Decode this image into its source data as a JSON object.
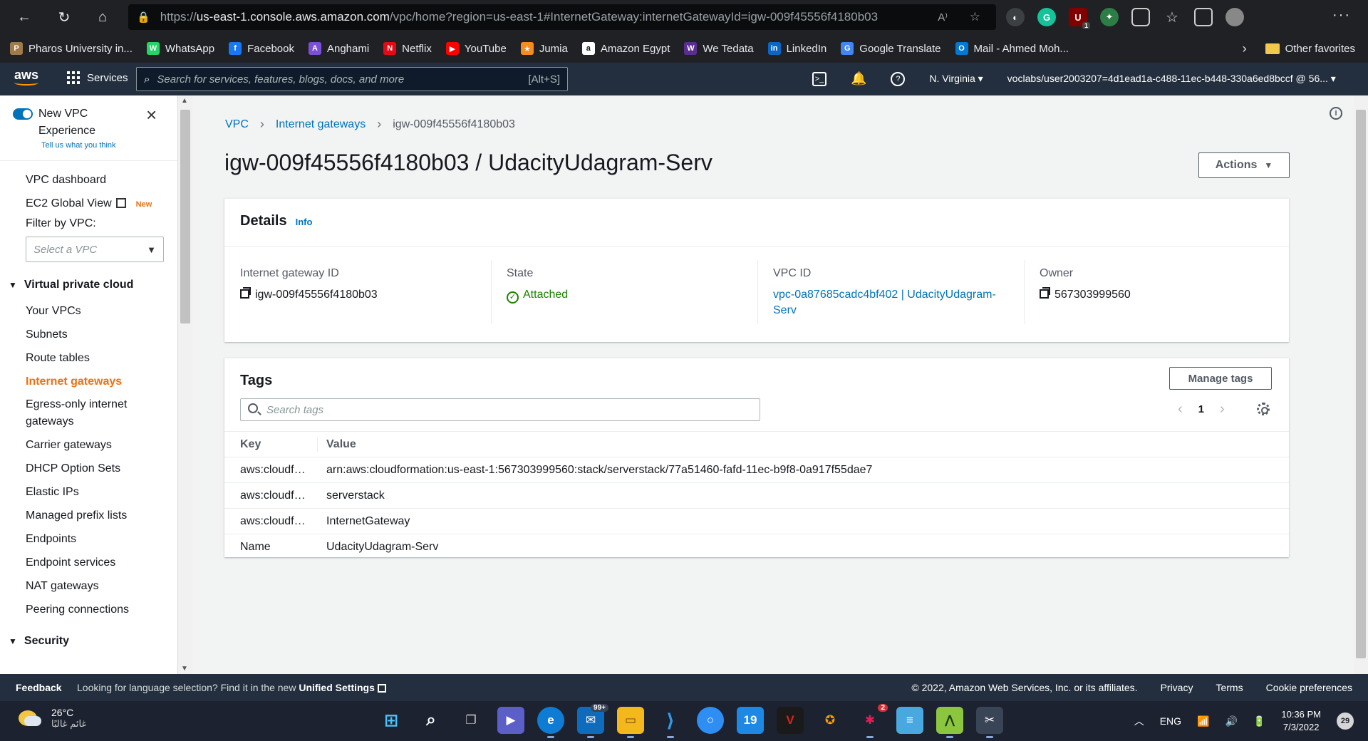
{
  "browser": {
    "url_prefix": "https://",
    "url_host": "us-east-1.console.aws.amazon.com",
    "url_path": "/vpc/home?region=us-east-1#InternetGateway:internetGatewayId=igw-009f45556f4180b03",
    "extension_badge": "1",
    "bookmarks": [
      {
        "label": "Pharos University in...",
        "color": "#a07a4a",
        "glyph": "P"
      },
      {
        "label": "WhatsApp",
        "color": "#25d366",
        "glyph": "W"
      },
      {
        "label": "Facebook",
        "color": "#1877f2",
        "glyph": "f"
      },
      {
        "label": "Anghami",
        "color": "#7b4fd6",
        "glyph": "A"
      },
      {
        "label": "Netflix",
        "color": "#e50914",
        "glyph": "N"
      },
      {
        "label": "YouTube",
        "color": "#ff0000",
        "glyph": "▶"
      },
      {
        "label": "Jumia",
        "color": "#f68b1e",
        "glyph": "★"
      },
      {
        "label": "Amazon Egypt",
        "color": "#ffffff",
        "glyph": "a"
      },
      {
        "label": "We Tedata",
        "color": "#5c2d91",
        "glyph": "W"
      },
      {
        "label": "LinkedIn",
        "color": "#0a66c2",
        "glyph": "in"
      },
      {
        "label": "Google Translate",
        "color": "#4285f4",
        "glyph": "G"
      },
      {
        "label": "Mail - Ahmed Moh...",
        "color": "#0078d4",
        "glyph": "O"
      }
    ],
    "other_favorites": "Other favorites"
  },
  "aws_header": {
    "logo": "aws",
    "services": "Services",
    "search_placeholder": "Search for services, features, blogs, docs, and more",
    "search_shortcut": "[Alt+S]",
    "region": "N. Virginia",
    "account": "voclabs/user2003207=4d1ead1a-c488-11ec-b448-330a6ed8bccf @ 56..."
  },
  "sidebar": {
    "new_vpc_label": "New VPC Experience",
    "feedback_link": "Tell us what you think",
    "top_items": [
      "VPC dashboard",
      "EC2 Global View"
    ],
    "new_badge": "New",
    "filter_label": "Filter by VPC:",
    "filter_placeholder": "Select a VPC",
    "section_vpc": "Virtual private cloud",
    "items": [
      "Your VPCs",
      "Subnets",
      "Route tables",
      "Internet gateways",
      "Egress-only internet gateways",
      "Carrier gateways",
      "DHCP Option Sets",
      "Elastic IPs",
      "Managed prefix lists",
      "Endpoints",
      "Endpoint services",
      "NAT gateways",
      "Peering connections"
    ],
    "active_item": "Internet gateways",
    "section_security": "Security"
  },
  "breadcrumb": {
    "root": "VPC",
    "parent": "Internet gateways",
    "current": "igw-009f45556f4180b03"
  },
  "page": {
    "title": "igw-009f45556f4180b03 / UdacityUdagram-Serv",
    "actions": "Actions"
  },
  "details": {
    "heading": "Details",
    "info": "Info",
    "igw_label": "Internet gateway ID",
    "igw_value": "igw-009f45556f4180b03",
    "state_label": "State",
    "state_value": "Attached",
    "vpc_label": "VPC ID",
    "vpc_value": "vpc-0a87685cadc4bf402 | UdacityUdagram-Serv",
    "owner_label": "Owner",
    "owner_value": "567303999560"
  },
  "tags": {
    "heading": "Tags",
    "manage": "Manage tags",
    "search_placeholder": "Search tags",
    "page": "1",
    "col_key": "Key",
    "col_value": "Value",
    "rows": [
      {
        "key": "aws:cloudf…",
        "value": "arn:aws:cloudformation:us-east-1:567303999560:stack/serverstack/77a51460-fafd-11ec-b9f8-0a917f55dae7"
      },
      {
        "key": "aws:cloudf…",
        "value": "serverstack"
      },
      {
        "key": "aws:cloudf…",
        "value": "InternetGateway"
      },
      {
        "key": "Name",
        "value": "UdacityUdagram-Serv"
      }
    ]
  },
  "footer": {
    "feedback": "Feedback",
    "lang_text": "Looking for language selection? Find it in the new",
    "lang_link": "Unified Settings",
    "copyright": "© 2022, Amazon Web Services, Inc. or its affiliates.",
    "privacy": "Privacy",
    "terms": "Terms",
    "cookies": "Cookie preferences"
  },
  "taskbar": {
    "temp": "26°C",
    "weather_desc": "غائم غالبًا",
    "mail_badge": "99+",
    "slack_badge": "2",
    "lang": "ENG",
    "time": "10:36 PM",
    "date": "7/3/2022",
    "notifications": "29"
  }
}
